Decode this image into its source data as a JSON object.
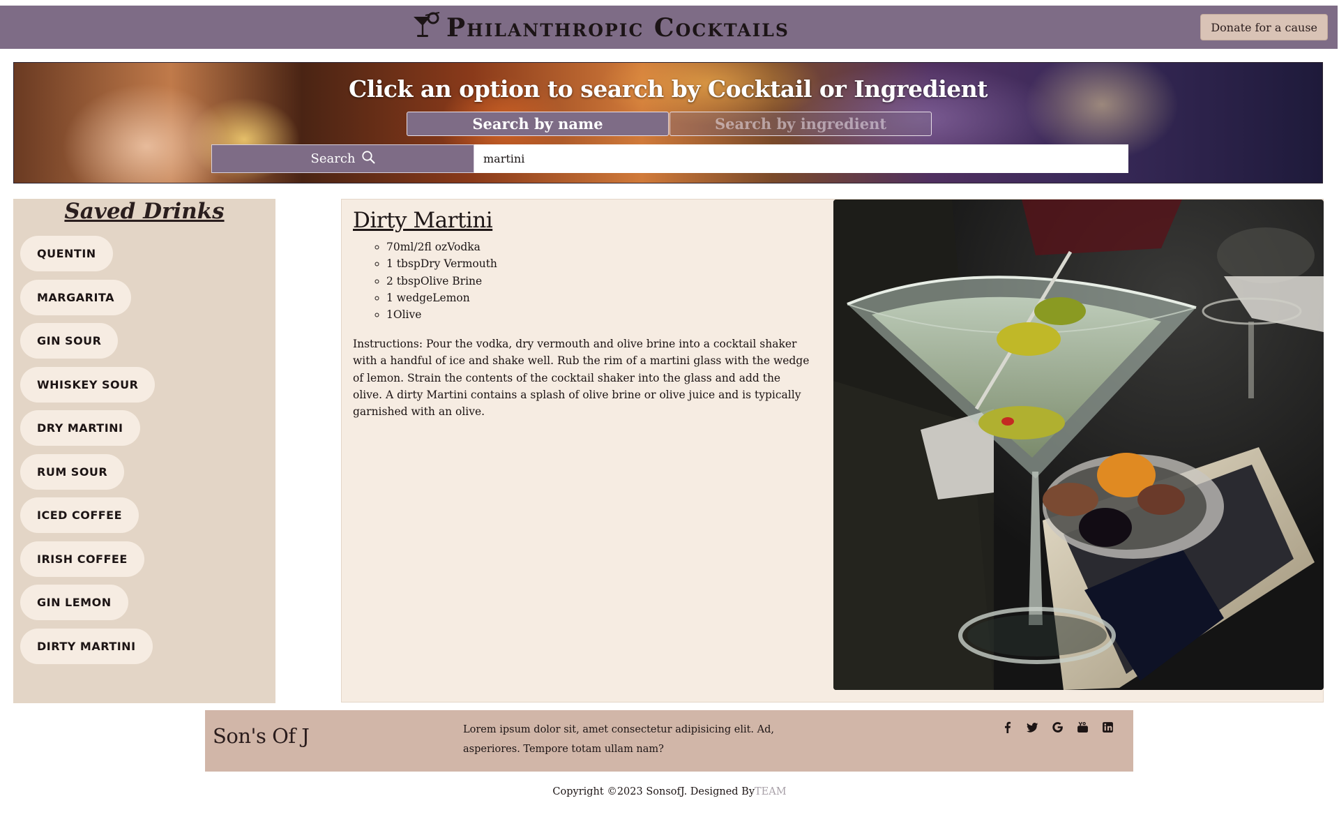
{
  "header": {
    "brand": "Philanthropic Cocktails",
    "logo_icon": "cocktail-glass-icon",
    "donate_label": "Donate for a cause",
    "bar_color": "#7e6c86"
  },
  "search": {
    "heading": "Click an option to search by Cocktail or Ingredient",
    "tabs": [
      {
        "label": "Search by name",
        "active": true
      },
      {
        "label": "Search by ingredient",
        "active": false
      }
    ],
    "button_label": "Search",
    "button_icon": "search-icon",
    "query": "martini"
  },
  "sidebar": {
    "title": "Saved Drinks",
    "items": [
      {
        "label": "QUENTIN"
      },
      {
        "label": "MARGARITA"
      },
      {
        "label": "GIN SOUR"
      },
      {
        "label": "WHISKEY SOUR"
      },
      {
        "label": "DRY MARTINI"
      },
      {
        "label": "RUM SOUR"
      },
      {
        "label": "ICED COFFEE"
      },
      {
        "label": "IRISH COFFEE"
      },
      {
        "label": "GIN LEMON"
      },
      {
        "label": "DIRTY MARTINI"
      }
    ]
  },
  "drink": {
    "name": "Dirty Martini",
    "ingredients": [
      {
        "text": "70ml/2fl ozVodka"
      },
      {
        "text": "1 tbspDry Vermouth"
      },
      {
        "text": "2 tbspOlive Brine"
      },
      {
        "text": "1 wedgeLemon"
      },
      {
        "text": "1Olive"
      }
    ],
    "instructions": "Instructions: Pour the vodka, dry vermouth and olive brine into a cocktail shaker with a handful of ice and shake well. Rub the rim of a martini glass with the wedge of lemon. Strain the contents of the cocktail shaker into the glass and add the olive. A dirty Martini contains a splash of olive brine or olive juice and is typically garnished with an olive."
  },
  "footer": {
    "brand": "Son's Of J",
    "text": "Lorem ipsum dolor sit, amet consectetur adipisicing elit. Ad, asperiores. Tempore totam ullam nam?",
    "social": [
      {
        "icon": "facebook-icon"
      },
      {
        "icon": "twitter-icon"
      },
      {
        "icon": "google-icon"
      },
      {
        "icon": "youtube-icon"
      },
      {
        "icon": "linkedin-icon"
      }
    ],
    "copyright": "Copyright ©2023 SonsofJ. Designed By",
    "designer_link": "TEAM",
    "color": "#d1b6a8"
  }
}
